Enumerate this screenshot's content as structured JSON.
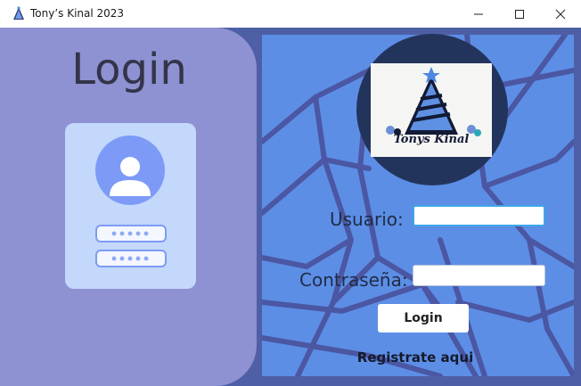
{
  "window": {
    "title": "Tony’s Kinal 2023",
    "icon": "party-hat-icon",
    "controls": [
      "minimize-icon",
      "maximize-icon",
      "close-icon"
    ]
  },
  "left_panel": {
    "heading": "Login",
    "illustration": "user-login-card-icon"
  },
  "logo": {
    "text": "Tonys Kinal",
    "icon": "party-hat-icon"
  },
  "form": {
    "username_label": "Usuario:",
    "username_value": "",
    "password_label": "Contraseña:",
    "password_value": "",
    "login_button": "Login",
    "register_link": "Registrate aqui"
  },
  "colors": {
    "frame": "#4e5fa6",
    "left_panel": "#8e91d2",
    "right_panel": "#5d8ee6",
    "logo_circle": "#23345c",
    "focus_border": "#3ea7e8"
  }
}
